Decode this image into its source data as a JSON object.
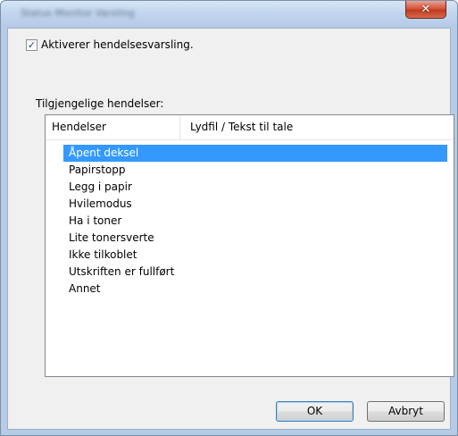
{
  "window": {
    "title": "Status Monitor Varsling",
    "close_icon": "close-icon"
  },
  "enable_notifications": {
    "label": "Aktiverer hendelsesvarsling.",
    "checked": true
  },
  "events_group": {
    "label": "Tilgjengelige hendelser:",
    "columns": [
      "Hendelser",
      "Lydfil / Tekst til tale"
    ],
    "rows": [
      {
        "event": "Åpent deksel",
        "selected": true
      },
      {
        "event": "Papirstopp",
        "selected": false
      },
      {
        "event": "Legg i papir",
        "selected": false
      },
      {
        "event": "Hvilemodus",
        "selected": false
      },
      {
        "event": "Ha i toner",
        "selected": false
      },
      {
        "event": "Lite tonersverte",
        "selected": false
      },
      {
        "event": "Ikke tilkoblet",
        "selected": false
      },
      {
        "event": "Utskriften er fullført",
        "selected": false
      },
      {
        "event": "Annet",
        "selected": false
      }
    ]
  },
  "buttons": {
    "ok": "OK",
    "cancel": "Avbryt"
  },
  "colors": {
    "selection": "#3399ff",
    "close_button": "#c03b1f"
  }
}
